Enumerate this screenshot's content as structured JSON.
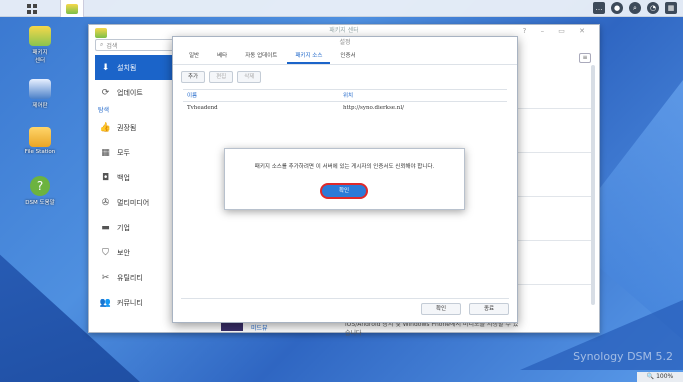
{
  "taskbar": {
    "zoom": "100%"
  },
  "desktop": {
    "icons": [
      {
        "label": "패키지\n센터"
      },
      {
        "label": "제어판"
      },
      {
        "label": "File Station"
      },
      {
        "label": "DSM 도움말"
      }
    ],
    "brand": "Synology DSM 5.2"
  },
  "window": {
    "title": "패키지 센터",
    "search_placeholder": "검색",
    "sidebar": {
      "installed": "설치됨",
      "updates": "업데이트",
      "explore": "탐색",
      "items": [
        "권장됨",
        "모두",
        "백업",
        "멀티미디어",
        "기업",
        "보안",
        "유틸리티",
        "커뮤니티"
      ]
    },
    "bottom_package": {
      "name": "미드뷰",
      "desc": "iOS/Android 장치 및 Windows Phone에서 비디오를 시청할 수 있습니다"
    }
  },
  "settings": {
    "title": "설정",
    "tabs": [
      "일반",
      "베타",
      "자동 업데이트",
      "패키지 소스",
      "인증서"
    ],
    "active_tab": 3,
    "toolbar": {
      "add": "추가",
      "edit": "편집",
      "delete": "삭제"
    },
    "table": {
      "headers": [
        "이름",
        "위치"
      ],
      "rows": [
        [
          "Tvheadend",
          "http://syno.dierkse.nl/"
        ]
      ]
    },
    "footer": {
      "ok": "확인",
      "cancel": "종료"
    }
  },
  "alert": {
    "message": "패키지 소스를 추가하려면 이 서버에 있는 게시자의 인증서도 신뢰해야 합니다.",
    "ok": "확인"
  },
  "colors": {
    "accent": "#1b64c9",
    "highlight": "#e02a2a"
  }
}
